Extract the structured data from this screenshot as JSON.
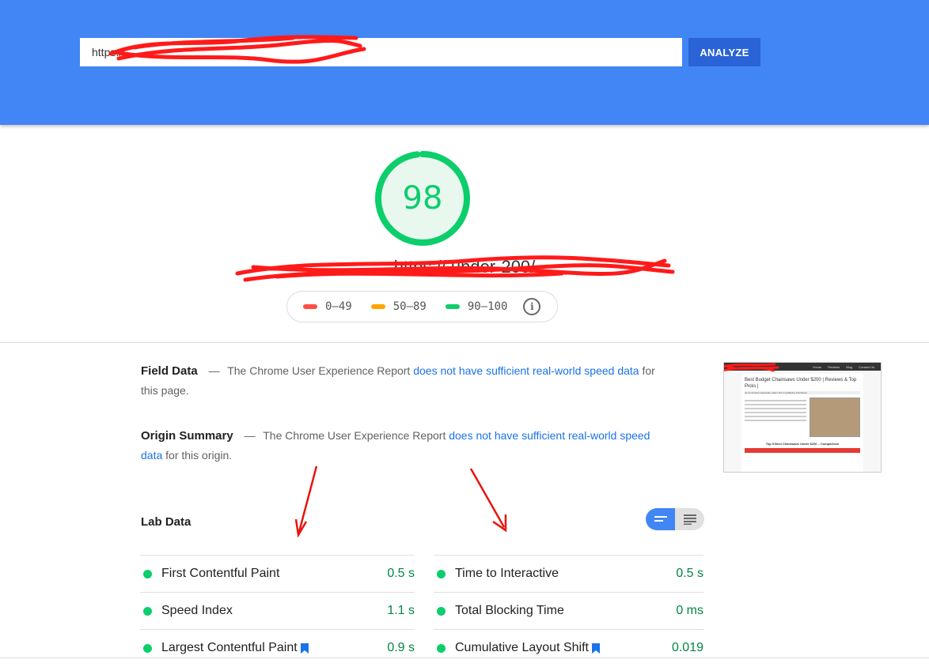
{
  "header": {
    "url_value": "https://",
    "analyze_label": "ANALYZE",
    "bg_color": "#4285f4"
  },
  "score": {
    "value": "98",
    "fraction": 0.98,
    "color": "#0cce6b",
    "page_url": "https://                                        under-200/"
  },
  "legend": {
    "items": [
      {
        "label": "0–49",
        "color": "#ff4e42"
      },
      {
        "label": "50–89",
        "color": "#ffa400"
      },
      {
        "label": "90–100",
        "color": "#0cce6b"
      }
    ],
    "info_icon": "info-icon"
  },
  "field_data": {
    "title": "Field Data",
    "dash": "—",
    "text_before": "The Chrome User Experience Report",
    "link": "does not have sufficient real-world speed data",
    "text_after": "for this page."
  },
  "origin_summary": {
    "title": "Origin Summary",
    "dash": "—",
    "text_before": "The Chrome User Experience Report",
    "link": "does not have sufficient real-world speed data",
    "text_after": "for this origin."
  },
  "thumbnail": {
    "title": "Best Budget Chainsaws Under $200 | Reviews & Top Picks |",
    "subtitle": "As an Amazon Associate I Earn From Qualifying Purchases",
    "table_heading": "Top 5 Best Chainsaws Under $200 – Comparison",
    "nav": [
      "Home",
      "Reviews",
      "Blog",
      "Contact Us"
    ]
  },
  "lab_data": {
    "title": "Lab Data",
    "metrics_left": [
      {
        "name": "First Contentful Paint",
        "value": "0.5 s",
        "bookmark": false
      },
      {
        "name": "Speed Index",
        "value": "1.1 s",
        "bookmark": false
      },
      {
        "name": "Largest Contentful Paint",
        "value": "0.9 s",
        "bookmark": true
      }
    ],
    "metrics_right": [
      {
        "name": "Time to Interactive",
        "value": "0.5 s",
        "bookmark": false
      },
      {
        "name": "Total Blocking Time",
        "value": "0 ms",
        "bookmark": false
      },
      {
        "name": "Cumulative Layout Shift",
        "value": "0.019",
        "bookmark": true
      }
    ]
  }
}
